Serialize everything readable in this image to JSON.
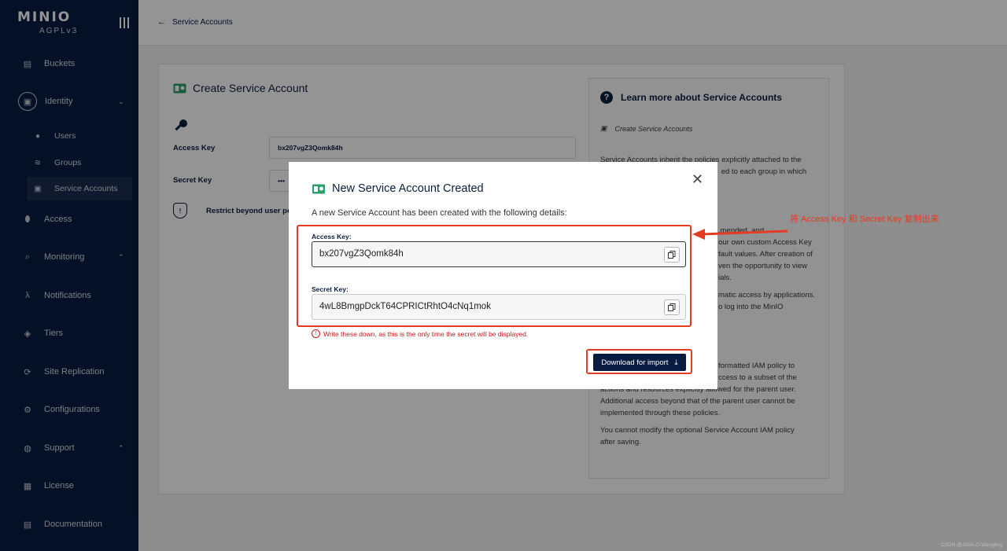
{
  "sidebar": {
    "logo_main": "MINIO",
    "logo_sub": "AGPLv3",
    "items": {
      "buckets": "Buckets",
      "identity": "Identity",
      "users": "Users",
      "groups": "Groups",
      "service_accounts": "Service Accounts",
      "access": "Access",
      "monitoring": "Monitoring",
      "notifications": "Notifications",
      "tiers": "Tiers",
      "site_replication": "Site Replication",
      "configurations": "Configurations",
      "support": "Support",
      "license": "License",
      "documentation": "Documentation"
    }
  },
  "header": {
    "back_label": "Service Accounts"
  },
  "form": {
    "title": "Create Service Account",
    "access_key_label": "Access Key",
    "access_key_value": "bx207vgZ3Qomk84h",
    "secret_key_label": "Secret Key",
    "secret_key_masked": "•••",
    "restrict_label": "Restrict beyond user po"
  },
  "help": {
    "title": "Learn more about Service Accounts",
    "subtitle": "Create Service Accounts",
    "p1": "Service Accounts inherit the policies explicitly attached to the",
    "p1b": "ed to each group in which",
    "p2": ".mended, and",
    "p2b": "our own custom Access Key",
    "p2c": "fault values. After creation of",
    "p2d": "ven the opportunity to view",
    "p2e": "ials.",
    "p3": "matic access by applications.",
    "p3b": "o log into the MinIO",
    "p4": "formatted IAM policy to",
    "p4b": "ccess to a subset of the",
    "p4c": "actions and resources explicitly allowed for the parent user.",
    "p4d": "Additional access beyond that of the parent user cannot be",
    "p4e": "implemented through these policies.",
    "p5": "You cannot modify the optional Service Account IAM policy",
    "p5b": "after saving."
  },
  "modal": {
    "title": "New Service Account Created",
    "description": "A new Service Account has been created with the following details:",
    "access_key_label": "Access Key:",
    "access_key_value": "bx207vgZ3Qomk84h",
    "secret_key_label": "Secret Key:",
    "secret_key_value": "4wL8BmgpDckT64CPRICtRhtO4cNq1mok",
    "warning": "Write these down, as this is the only time the secret will be displayed.",
    "download_label": "Download for import",
    "close_symbol": "✕"
  },
  "annotation": {
    "text": "将 Access Key 和 Secret Key 复制出来"
  },
  "watermark": "CSDN @JAVA-D-Wangling",
  "colors": {
    "sidebar_bg": "#081c42",
    "primary": "#081c42",
    "warning": "#c51b1b",
    "annotation": "#e53b22"
  }
}
